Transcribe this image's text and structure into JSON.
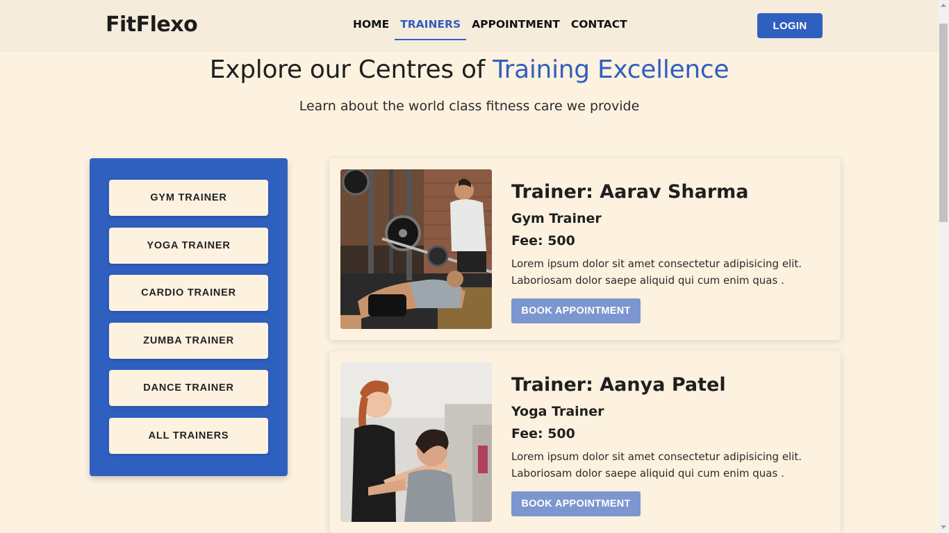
{
  "navbar": {
    "brand": "FitFlexo",
    "links": [
      {
        "label": "HOME",
        "active": false
      },
      {
        "label": "TRAINERS",
        "active": true
      },
      {
        "label": "APPOINTMENT",
        "active": false
      },
      {
        "label": "CONTACT",
        "active": false
      }
    ],
    "login_label": "LOGIN"
  },
  "hero": {
    "title_plain": "Explore our Centres of ",
    "title_accent": "Training Excellence",
    "subtitle": "Learn about the world class fitness care we provide"
  },
  "categories": [
    {
      "label": "GYM TRAINER"
    },
    {
      "label": "YOGA TRAINER"
    },
    {
      "label": "CARDIO TRAINER"
    },
    {
      "label": "ZUMBA TRAINER"
    },
    {
      "label": "DANCE TRAINER"
    },
    {
      "label": "ALL TRAINERS"
    }
  ],
  "trainers": [
    {
      "name": "Trainer: Aarav Sharma",
      "specialty": "Gym Trainer",
      "fee": "Fee: 500",
      "description": "Lorem ipsum dolor sit amet consectetur adipisicing elit. Laboriosam dolor saepe aliquid qui cum enim quas .",
      "button_label": "BOOK APPOINTMENT"
    },
    {
      "name": "Trainer: Aanya Patel",
      "specialty": "Yoga Trainer",
      "fee": "Fee: 500",
      "description": "Lorem ipsum dolor sit amet consectetur adipisicing elit. Laboriosam dolor saepe aliquid qui cum enim quas .",
      "button_label": "BOOK APPOINTMENT"
    }
  ],
  "colors": {
    "accent": "#2f5fbf",
    "background": "#fdf2e0",
    "navbar_bg": "#f6ecdc",
    "button_muted": "#7c96cf"
  }
}
